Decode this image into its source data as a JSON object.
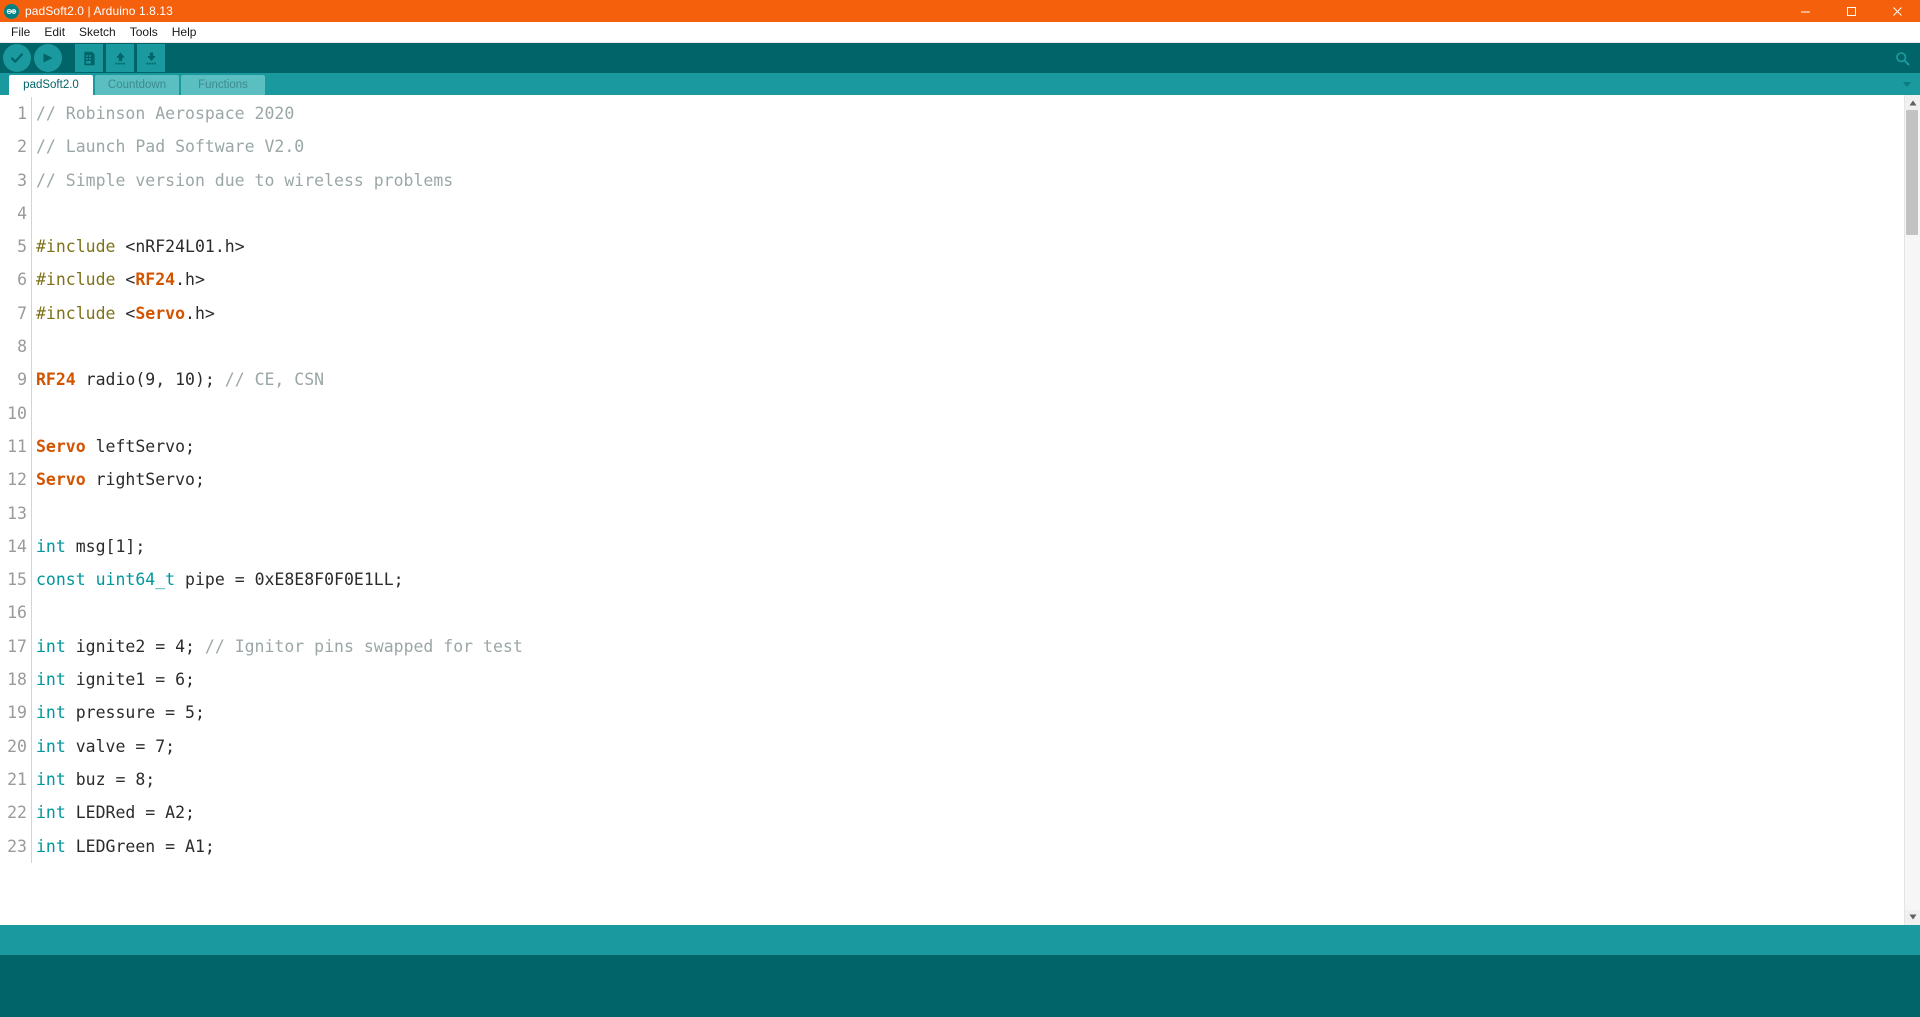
{
  "window": {
    "title": "padSoft2.0 | Arduino 1.8.13",
    "logo_icon": "arduino-infinity-icon",
    "controls": [
      {
        "name": "minimize",
        "icon": "minimize-icon"
      },
      {
        "name": "maximize",
        "icon": "maximize-icon"
      },
      {
        "name": "close",
        "icon": "close-icon"
      }
    ],
    "colors": {
      "titlebar": "#f4600c",
      "toolbar": "#006468",
      "tabbar": "#1a9a9e",
      "console": "#1a9a9e",
      "status": "#006468"
    }
  },
  "menubar": {
    "items": [
      {
        "label": "File"
      },
      {
        "label": "Edit"
      },
      {
        "label": "Sketch"
      },
      {
        "label": "Tools"
      },
      {
        "label": "Help"
      }
    ]
  },
  "toolbar": {
    "buttons": [
      {
        "name": "verify-button",
        "icon": "checkmark-icon",
        "title": "Verify"
      },
      {
        "name": "upload-button",
        "icon": "arrow-right-icon",
        "title": "Upload"
      },
      {
        "name": "new-button",
        "icon": "new-file-icon",
        "title": "New"
      },
      {
        "name": "open-button",
        "icon": "arrow-up-icon",
        "title": "Open"
      },
      {
        "name": "save-button",
        "icon": "arrow-down-icon",
        "title": "Save"
      }
    ],
    "serial_monitor": {
      "name": "serial-monitor-button",
      "icon": "magnifier-icon",
      "title": "Serial Monitor"
    }
  },
  "tabs": {
    "items": [
      {
        "label": "padSoft2.0",
        "active": true
      },
      {
        "label": "Countdown",
        "active": false
      },
      {
        "label": "Functions",
        "active": false
      }
    ],
    "menu_icon": "chevron-down-icon"
  },
  "editor": {
    "scrollbar": {
      "up_icon": "caret-up-icon",
      "down_icon": "caret-down-icon"
    },
    "lines": [
      {
        "num": "1",
        "tokens": [
          {
            "t": "// Robinson Aerospace 2020",
            "c": "comment"
          }
        ]
      },
      {
        "num": "2",
        "tokens": [
          {
            "t": "// Launch Pad Software V2.0",
            "c": "comment"
          }
        ]
      },
      {
        "num": "3",
        "tokens": [
          {
            "t": "// Simple version due to wireless problems",
            "c": "comment"
          }
        ]
      },
      {
        "num": "4",
        "tokens": [
          {
            "t": "",
            "c": "plain"
          }
        ]
      },
      {
        "num": "5",
        "tokens": [
          {
            "t": "#include",
            "c": "pre"
          },
          {
            "t": " <nRF24L01.h>",
            "c": "plain"
          }
        ]
      },
      {
        "num": "6",
        "tokens": [
          {
            "t": "#include",
            "c": "pre"
          },
          {
            "t": " <",
            "c": "plain"
          },
          {
            "t": "RF24",
            "c": "lib"
          },
          {
            "t": ".h>",
            "c": "plain"
          }
        ]
      },
      {
        "num": "7",
        "tokens": [
          {
            "t": "#include",
            "c": "pre"
          },
          {
            "t": " <",
            "c": "plain"
          },
          {
            "t": "Servo",
            "c": "lib"
          },
          {
            "t": ".h>",
            "c": "plain"
          }
        ]
      },
      {
        "num": "8",
        "tokens": [
          {
            "t": "",
            "c": "plain"
          }
        ]
      },
      {
        "num": "9",
        "tokens": [
          {
            "t": "RF24",
            "c": "lib"
          },
          {
            "t": " radio(9, 10); ",
            "c": "plain"
          },
          {
            "t": "// CE, CSN",
            "c": "comment"
          }
        ]
      },
      {
        "num": "10",
        "tokens": [
          {
            "t": "",
            "c": "plain"
          }
        ]
      },
      {
        "num": "11",
        "tokens": [
          {
            "t": "Servo",
            "c": "lib"
          },
          {
            "t": " leftServo;",
            "c": "plain"
          }
        ]
      },
      {
        "num": "12",
        "tokens": [
          {
            "t": "Servo",
            "c": "lib"
          },
          {
            "t": " rightServo;",
            "c": "plain"
          }
        ]
      },
      {
        "num": "13",
        "tokens": [
          {
            "t": "",
            "c": "plain"
          }
        ]
      },
      {
        "num": "14",
        "tokens": [
          {
            "t": "int",
            "c": "type"
          },
          {
            "t": " msg[1];",
            "c": "plain"
          }
        ]
      },
      {
        "num": "15",
        "tokens": [
          {
            "t": "const",
            "c": "type"
          },
          {
            "t": " ",
            "c": "plain"
          },
          {
            "t": "uint64_t",
            "c": "type"
          },
          {
            "t": " pipe = 0xE8E8F0F0E1LL;",
            "c": "plain"
          }
        ]
      },
      {
        "num": "16",
        "tokens": [
          {
            "t": "",
            "c": "plain"
          }
        ]
      },
      {
        "num": "17",
        "tokens": [
          {
            "t": "int",
            "c": "type"
          },
          {
            "t": " ignite2 = 4; ",
            "c": "plain"
          },
          {
            "t": "// Ignitor pins swapped for test",
            "c": "comment"
          }
        ]
      },
      {
        "num": "18",
        "tokens": [
          {
            "t": "int",
            "c": "type"
          },
          {
            "t": " ignite1 = 6;",
            "c": "plain"
          }
        ]
      },
      {
        "num": "19",
        "tokens": [
          {
            "t": "int",
            "c": "type"
          },
          {
            "t": " pressure = 5;",
            "c": "plain"
          }
        ]
      },
      {
        "num": "20",
        "tokens": [
          {
            "t": "int",
            "c": "type"
          },
          {
            "t": " valve = 7;",
            "c": "plain"
          }
        ]
      },
      {
        "num": "21",
        "tokens": [
          {
            "t": "int",
            "c": "type"
          },
          {
            "t": " buz = 8;",
            "c": "plain"
          }
        ]
      },
      {
        "num": "22",
        "tokens": [
          {
            "t": "int",
            "c": "type"
          },
          {
            "t": " LEDRed = A2;",
            "c": "plain"
          }
        ]
      },
      {
        "num": "23",
        "tokens": [
          {
            "t": "int",
            "c": "type"
          },
          {
            "t": " LEDGreen = A1;",
            "c": "plain"
          }
        ]
      }
    ]
  },
  "console": {
    "message": "",
    "status": ""
  }
}
